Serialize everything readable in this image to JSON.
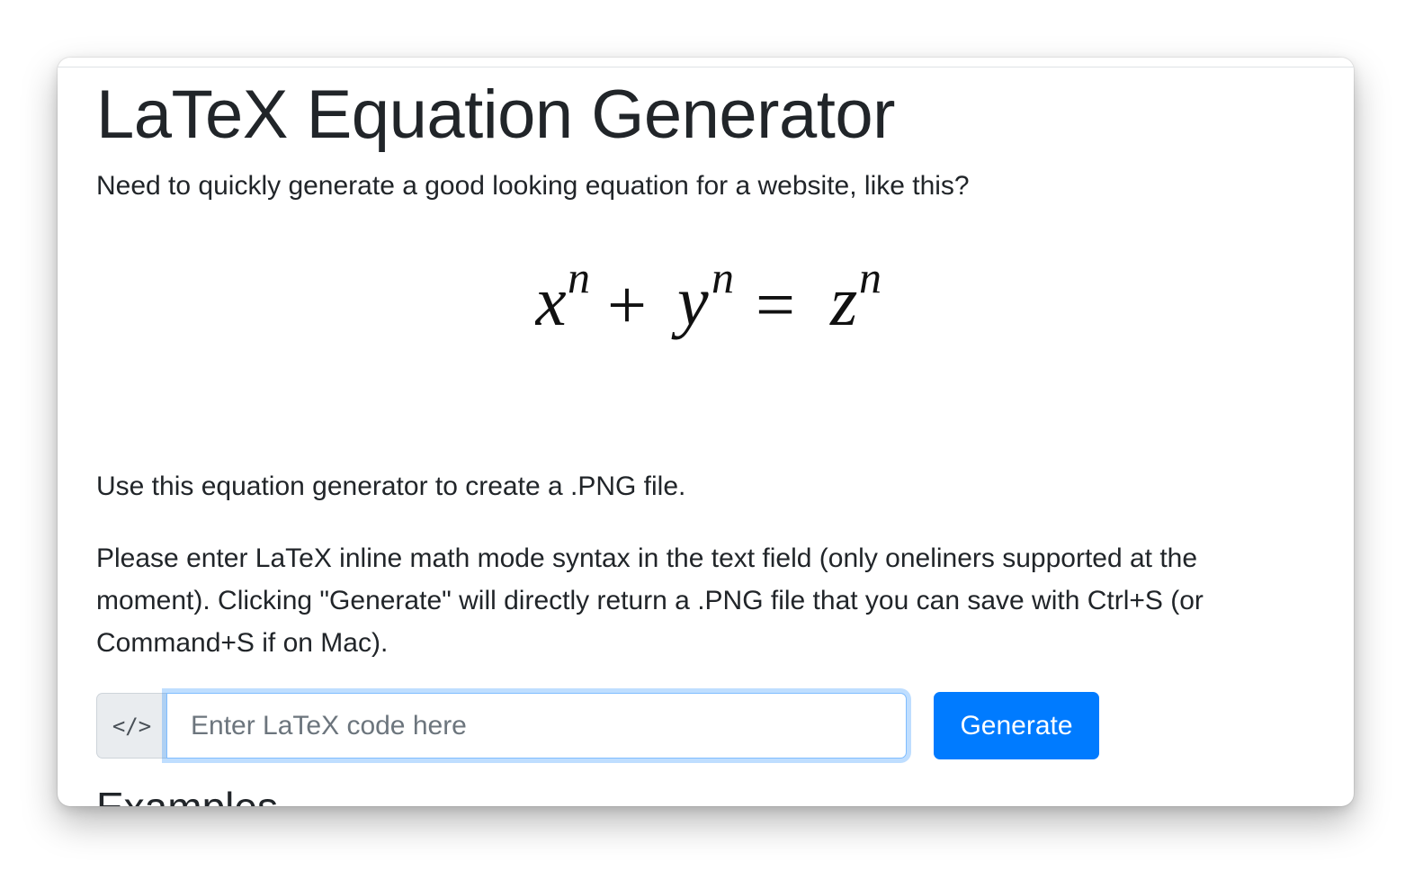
{
  "page": {
    "title": "LaTeX Equation Generator",
    "lead": "Need to quickly generate a good looking equation for a website, like this?",
    "equation_glyphs": {
      "x": "x",
      "y": "y",
      "z": "z",
      "n": "n",
      "plus": "+",
      "equals": "="
    },
    "intro": "Use this equation generator to create a .PNG file.",
    "instructions": "Please enter LaTeX inline math mode syntax in the text field (only oneliners supported at the moment). Clicking \"Generate\" will directly return a .PNG file that you can save with Ctrl+S (or Command+S if on Mac).",
    "next_heading": "Examples"
  },
  "form": {
    "prepend_icon": "code-icon",
    "prepend_glyph": "</>",
    "input_placeholder": "Enter LaTeX code here",
    "input_value": "",
    "generate_label": "Generate"
  },
  "colors": {
    "primary": "#007bff",
    "text": "#212529",
    "focus_ring": "#80bdff",
    "addon_bg": "#e9ecef"
  }
}
